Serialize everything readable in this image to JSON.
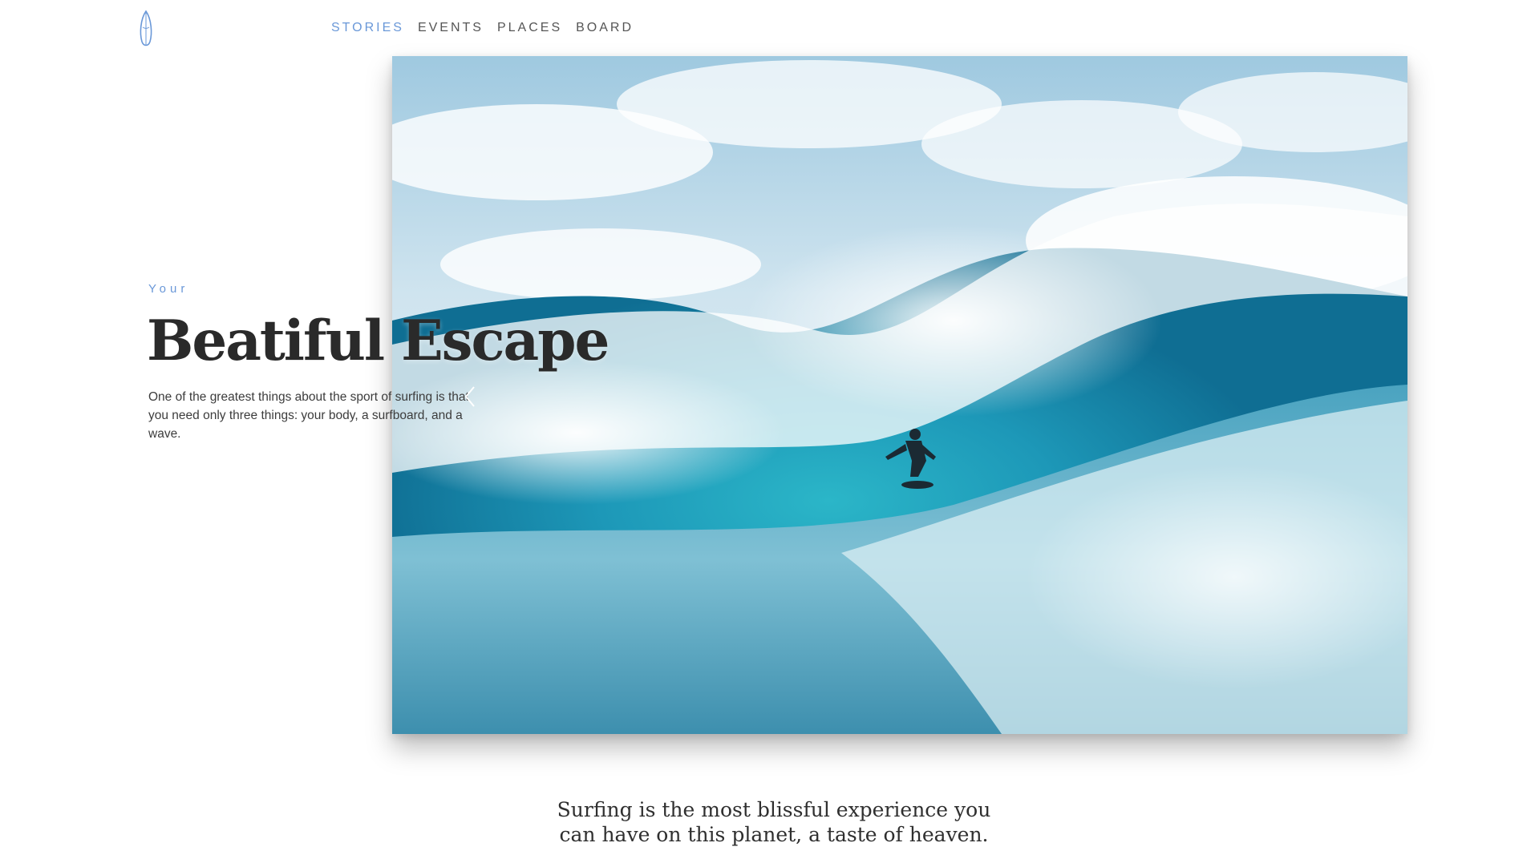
{
  "header": {
    "logo_icon": "surfboard-icon",
    "nav": [
      {
        "label": "STORIES",
        "active": true
      },
      {
        "label": "EVENTS",
        "active": false
      },
      {
        "label": "PLACES",
        "active": false
      },
      {
        "label": "BOARD",
        "active": false
      }
    ]
  },
  "hero": {
    "eyebrow": "Your",
    "title": "Beatiful Escape",
    "description": "One of the greatest things about the sport of surfing is that you need only three things: your body, a surfboard, and a wave.",
    "prev_icon": "chevron-left-icon"
  },
  "quote": {
    "line1": "Surfing is the most blissful experience you",
    "line2": "can have on this planet, a taste of heaven."
  },
  "colors": {
    "accent": "#6a98d8",
    "text": "#2a2a2a"
  }
}
